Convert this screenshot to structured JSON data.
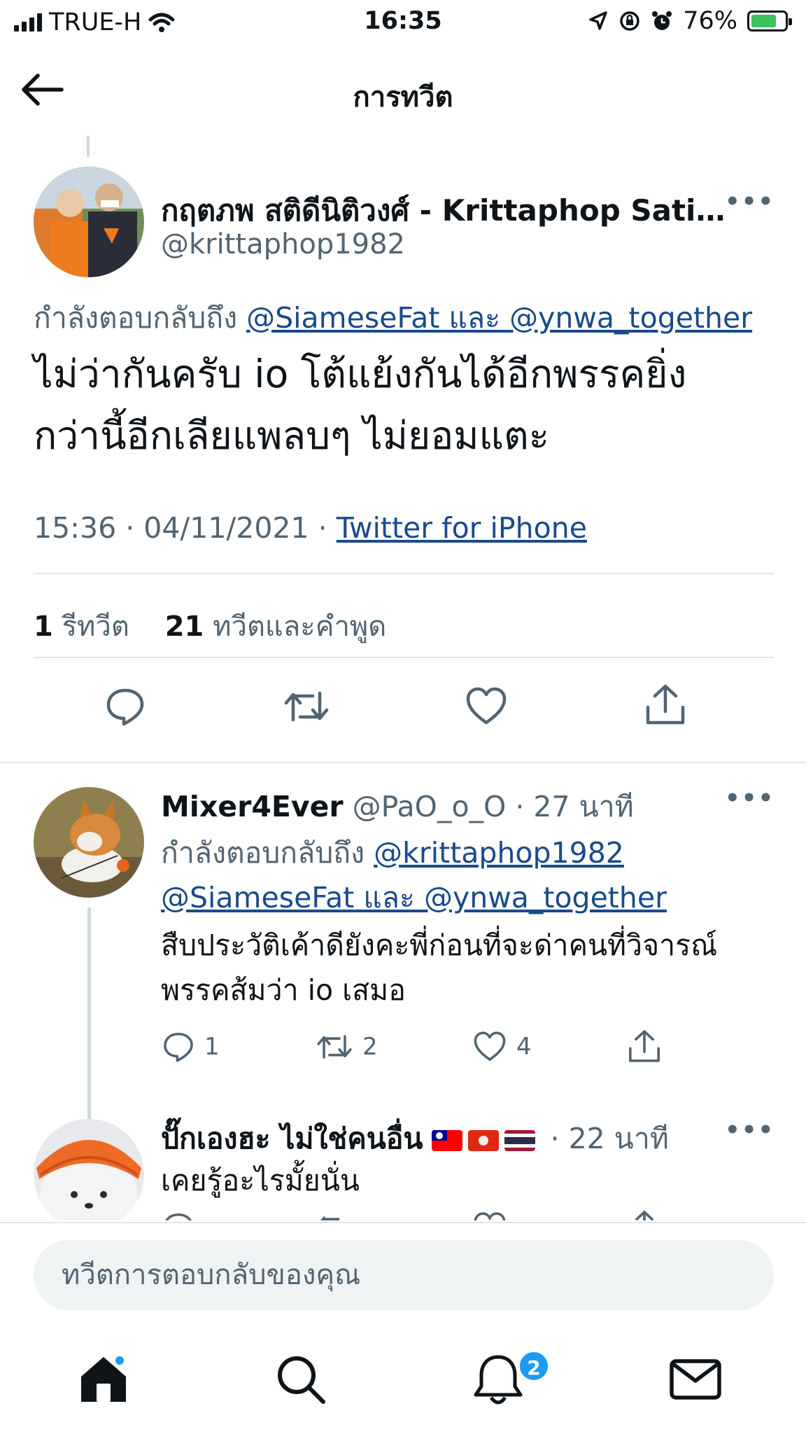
{
  "status_bar": {
    "carrier": "TRUE-H",
    "time": "16:35",
    "battery_percent": "76%",
    "battery_level": 0.76,
    "icons": [
      "signal-icon",
      "wifi-icon",
      "location-icon",
      "orientation-lock-icon",
      "alarm-icon",
      "battery-charging-icon"
    ]
  },
  "header": {
    "title": "การทวีต"
  },
  "main_tweet": {
    "author_name": "กฤตภพ สติดีนิติวงศ์ - Krittaphop Sati...",
    "author_handle": "@krittaphop1982",
    "reply_prefix": "กำลังตอบกลับถึง",
    "reply_mention_1": "@SiameseFat",
    "reply_and": "และ",
    "reply_mention_2": "@ynwa_together",
    "text_line_1": "ไม่ว่ากันครับ io โต้แย้งกันได้อีกพรรคยิ่ง",
    "text_line_2": "กว่านี้อีกเลียแพลบๆ ไม่ยอมแตะ",
    "time": "15:36",
    "date": "04/11/2021",
    "source": "Twitter for iPhone",
    "retweets_count": "1",
    "retweets_label": "รีทวีต",
    "quotes_count": "21",
    "quotes_label": "ทวีตและคำพูด"
  },
  "replies": [
    {
      "name": "Mixer4Ever",
      "handle": "@PaO_o_O",
      "age": "27 นาที",
      "reply_prefix": "กำลังตอบกลับถึง",
      "mention_1": "@krittaphop1982",
      "mention_2": "@SiameseFat",
      "and": "และ",
      "mention_3": "@ynwa_together",
      "text_line_1": "สืบประวัติเค้าดียังคะพี่ก่อนที่จะด่าคนที่วิจารณ์",
      "text_line_2": "พรรคส้มว่า io เสมอ",
      "reply_count": "1",
      "retweet_count": "2",
      "like_count": "4"
    },
    {
      "name": "ปั๊กเองฮะ ไม่ใช่คนอื่น",
      "age": "22 นาที",
      "text": "เคยรู้อะไรมั้ยนั่น",
      "flags": [
        "taiwan-flag-icon",
        "hong-kong-flag-icon",
        "thailand-flag-icon"
      ]
    }
  ],
  "reply_box": {
    "placeholder": "ทวีตการตอบกลับของคุณ"
  },
  "tabbar": {
    "notifications_badge": "2"
  },
  "colors": {
    "accent": "#1d9bf0",
    "muted": "#536471",
    "text": "#0f1419",
    "divider": "#e1e6e9"
  }
}
